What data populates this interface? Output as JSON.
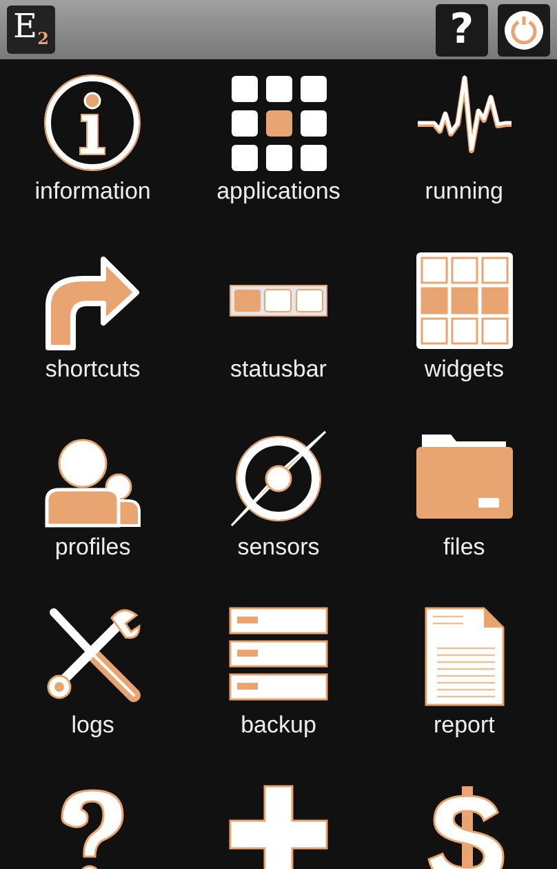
{
  "toolbar": {
    "logo": {
      "letter": "E",
      "subscript": "2"
    },
    "help_button": "?"
  },
  "items": [
    {
      "kind": "info",
      "label": "information"
    },
    {
      "kind": "apps",
      "label": "applications"
    },
    {
      "kind": "pulse",
      "label": "running"
    },
    {
      "kind": "share",
      "label": "shortcuts"
    },
    {
      "kind": "statusbar",
      "label": "statusbar"
    },
    {
      "kind": "widgets",
      "label": "widgets"
    },
    {
      "kind": "users",
      "label": "profiles"
    },
    {
      "kind": "compass",
      "label": "sensors"
    },
    {
      "kind": "folder",
      "label": "files"
    },
    {
      "kind": "tools",
      "label": "logs"
    },
    {
      "kind": "stack",
      "label": "backup"
    },
    {
      "kind": "document",
      "label": "report"
    },
    {
      "kind": "question"
    },
    {
      "kind": "plus"
    },
    {
      "kind": "dollar"
    }
  ]
}
